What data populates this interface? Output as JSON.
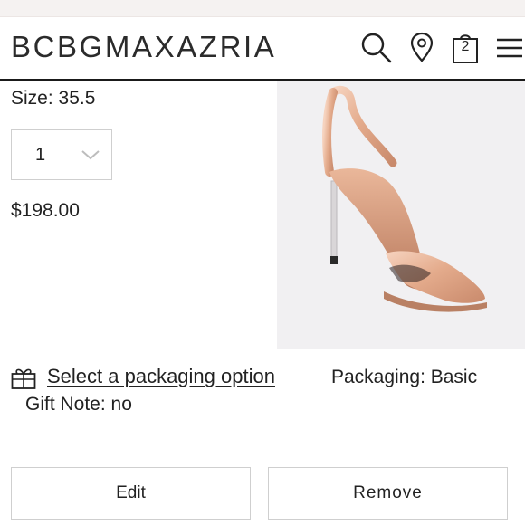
{
  "header": {
    "brand": "BCBGMAXAZRIA",
    "icons": [
      "search-icon",
      "location-pin-icon",
      "shopping-bag-icon",
      "hamburger-menu-icon"
    ],
    "bag_count": "2"
  },
  "item": {
    "size_label": "Size: 35.5",
    "quantity": "1",
    "price": "$198.00",
    "image": "rose-gold-slingback-sandal"
  },
  "packaging": {
    "gift_icon": "gift-icon",
    "link_text": "Select a packaging option",
    "status": "Packaging: Basic",
    "gift_note": "Gift Note: no"
  },
  "actions": {
    "edit_label": "Edit",
    "remove_label": "Remove"
  }
}
